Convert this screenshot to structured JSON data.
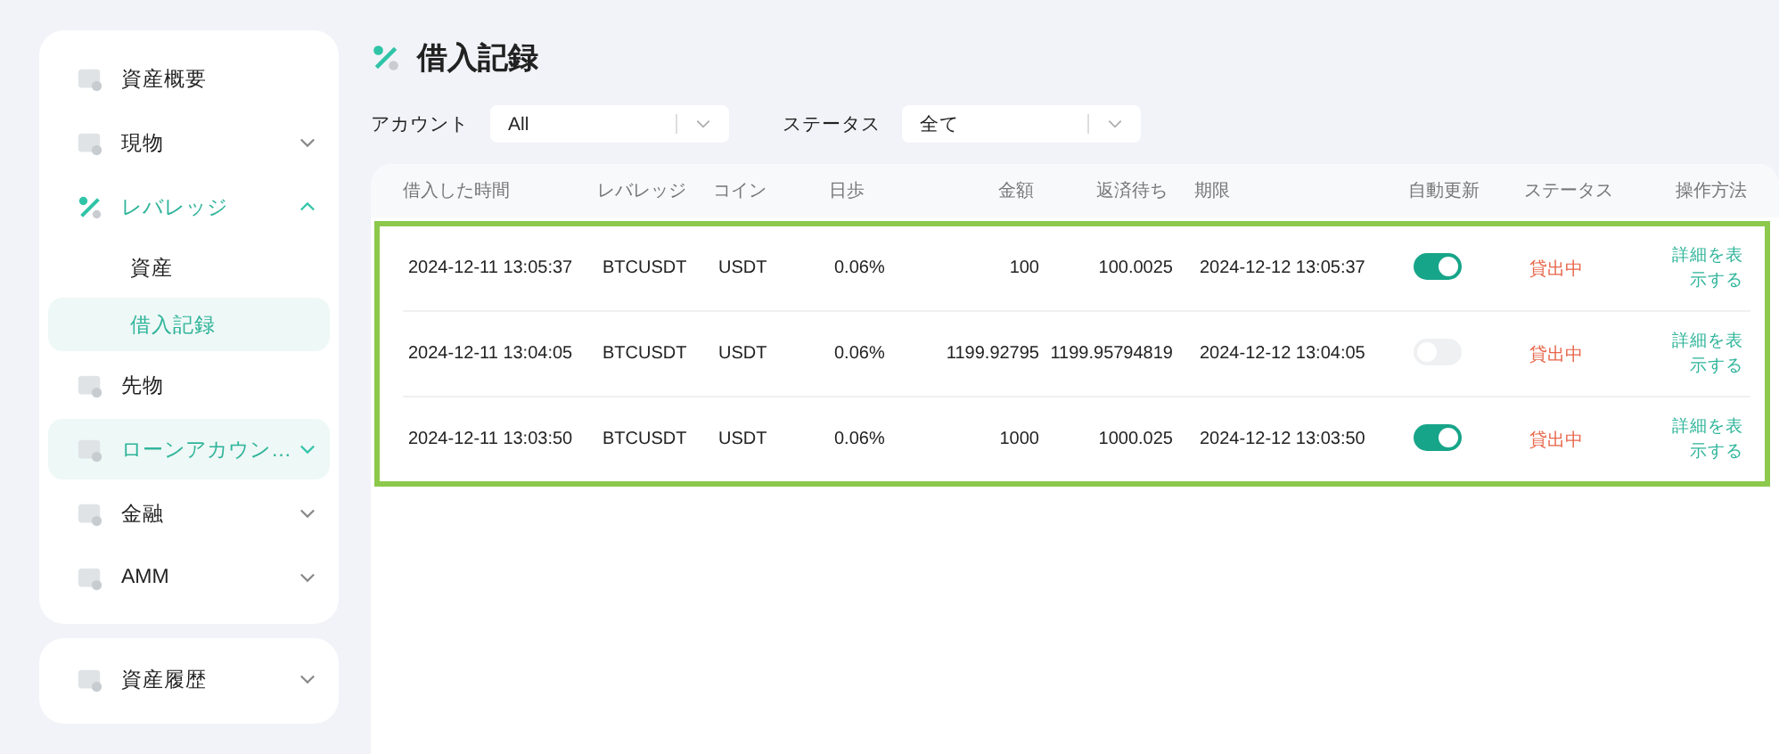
{
  "sidebar": {
    "groups": [
      {
        "items": [
          {
            "label": "資産概要",
            "active": false,
            "hovered": false
          },
          {
            "label": "現物",
            "expanded": false,
            "active": false,
            "hovered": false
          },
          {
            "label": "レバレッジ",
            "expanded": true,
            "active": true,
            "hovered": false,
            "children": [
              {
                "label": "資産",
                "selected": false
              },
              {
                "label": "借入記録",
                "selected": true
              }
            ]
          },
          {
            "label": "先物",
            "active": false,
            "hovered": false
          },
          {
            "label": "ローンアカウン…",
            "expanded": false,
            "active": true,
            "hovered": true
          },
          {
            "label": "金融",
            "expanded": false,
            "active": false,
            "hovered": false
          },
          {
            "label": "AMM",
            "expanded": false,
            "active": false,
            "hovered": false
          }
        ]
      },
      {
        "items": [
          {
            "label": "資産履歴",
            "expanded": false,
            "active": false,
            "hovered": false
          }
        ]
      }
    ]
  },
  "page": {
    "title": "借入記録"
  },
  "filters": [
    {
      "label": "アカウント",
      "value": "All"
    },
    {
      "label": "ステータス",
      "value": "全て"
    }
  ],
  "table": {
    "columns": [
      "借入した時間",
      "レバレッジ",
      "コイン",
      "日歩",
      "金額",
      "返済待ち",
      "期限",
      "自動更新",
      "ステータス",
      "操作方法"
    ],
    "rows": [
      {
        "time": "2024-12-11 13:05:37",
        "pair": "BTCUSDT",
        "coin": "USDT",
        "rate": "0.06%",
        "amount": "100",
        "repay": "100.0025",
        "due": "2024-12-12 13:05:37",
        "auto_renew": true,
        "status": "貸出中",
        "action": "詳細を表示する"
      },
      {
        "time": "2024-12-11 13:04:05",
        "pair": "BTCUSDT",
        "coin": "USDT",
        "rate": "0.06%",
        "amount": "1199.92795",
        "repay": "1199.95794819",
        "due": "2024-12-12 13:04:05",
        "auto_renew": false,
        "status": "貸出中",
        "action": "詳細を表示する"
      },
      {
        "time": "2024-12-11 13:03:50",
        "pair": "BTCUSDT",
        "coin": "USDT",
        "rate": "0.06%",
        "amount": "1000",
        "repay": "1000.025",
        "due": "2024-12-12 13:03:50",
        "auto_renew": true,
        "status": "貸出中",
        "action": "詳細を表示する"
      }
    ]
  }
}
